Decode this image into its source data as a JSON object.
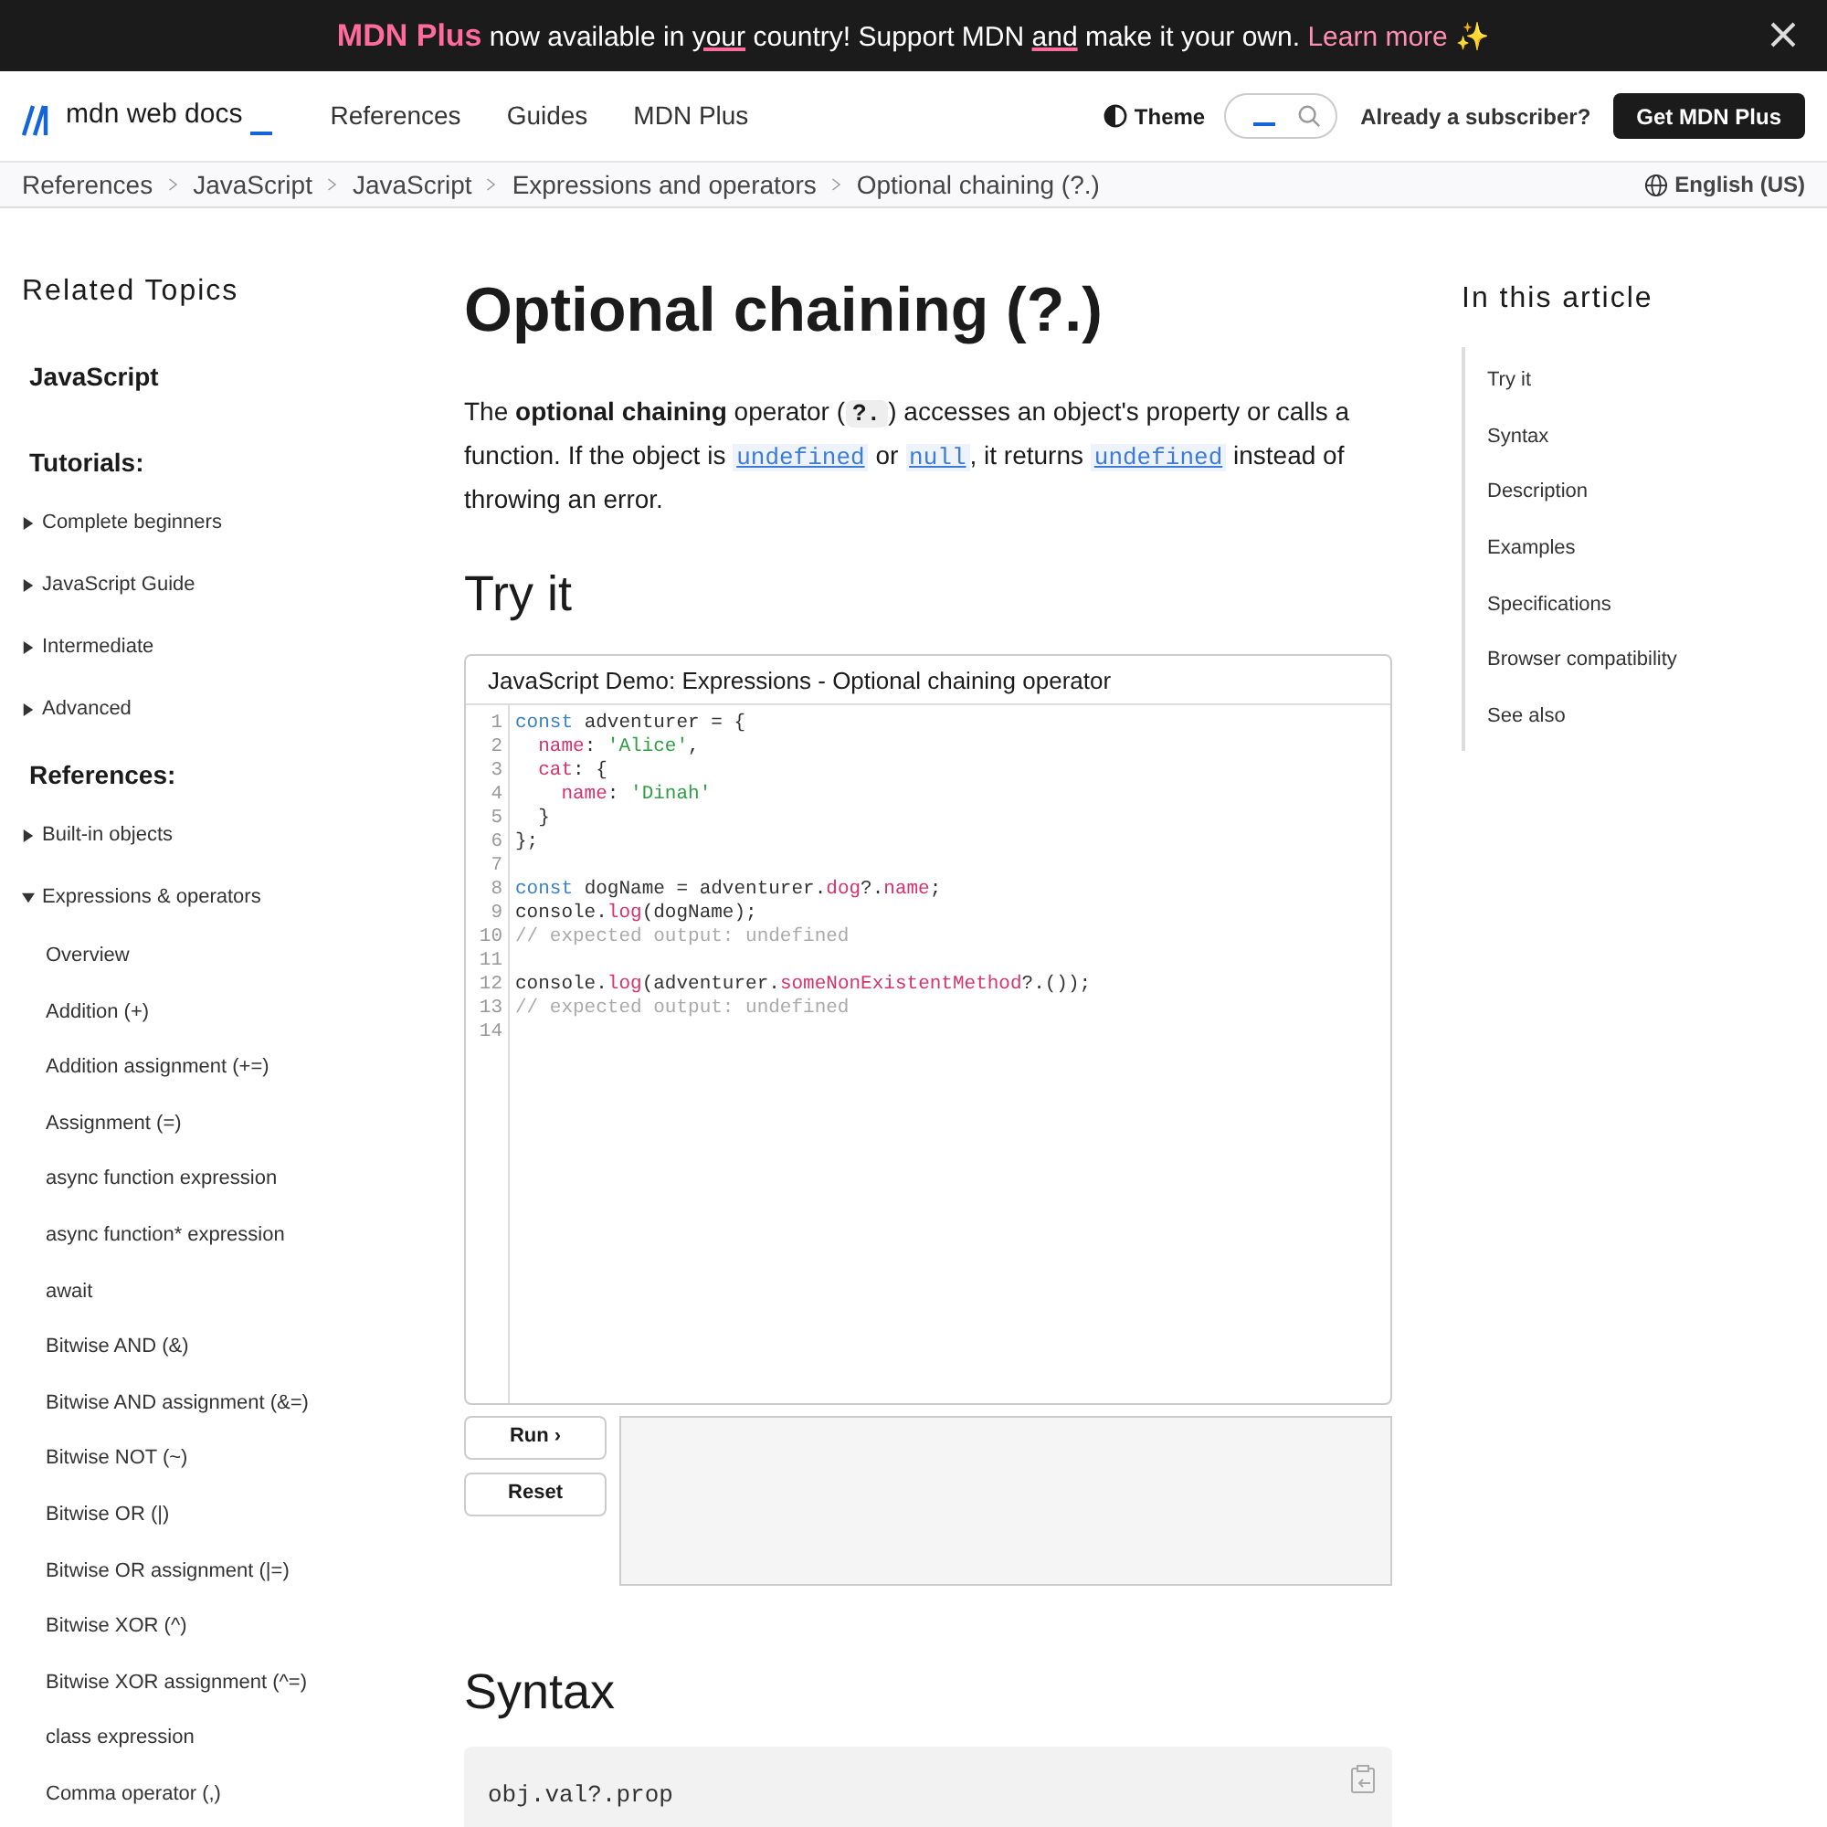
{
  "banner": {
    "parts": [
      {
        "kind": "brand",
        "text": "MDN Plus"
      },
      {
        "kind": "plain",
        "text": " now available in "
      },
      {
        "kind": "underline",
        "text": "your"
      },
      {
        "kind": "plain",
        "text": " country! Support MDN "
      },
      {
        "kind": "underline",
        "text": "and"
      },
      {
        "kind": "plain",
        "text": " make it your own. "
      },
      {
        "kind": "link",
        "text": "Learn more ✨"
      }
    ]
  },
  "header": {
    "logo": "mdn web docs",
    "nav": [
      "References",
      "Guides",
      "MDN Plus"
    ],
    "theme": "Theme",
    "subscriber": "Already a subscriber?",
    "cta": "Get MDN Plus"
  },
  "breadcrumbs": [
    "References",
    "JavaScript",
    "JavaScript",
    "Expressions and operators",
    "Optional chaining (?.)"
  ],
  "language": "English (US)",
  "sidebar": {
    "title": "Related Topics",
    "items": [
      {
        "kind": "heading",
        "text": "JavaScript"
      },
      {
        "kind": "section",
        "text": "Tutorials:"
      },
      {
        "kind": "toggle",
        "text": "Complete beginners",
        "expanded": false
      },
      {
        "kind": "toggle",
        "text": "JavaScript Guide",
        "expanded": false
      },
      {
        "kind": "toggle",
        "text": "Intermediate",
        "expanded": false
      },
      {
        "kind": "toggle",
        "text": "Advanced",
        "expanded": false
      },
      {
        "kind": "section",
        "text": "References:"
      },
      {
        "kind": "toggle",
        "text": "Built-in objects",
        "expanded": false
      },
      {
        "kind": "toggle",
        "text": "Expressions & operators",
        "expanded": true,
        "children": [
          "Overview",
          "Addition (+)",
          "Addition assignment (+=)",
          "Assignment (=)",
          "async function expression",
          "async function* expression",
          "await",
          "Bitwise AND (&)",
          "Bitwise AND assignment (&=)",
          "Bitwise NOT (~)",
          "Bitwise OR (|)",
          "Bitwise OR assignment (|=)",
          "Bitwise XOR (^)",
          "Bitwise XOR assignment (^=)",
          "class expression",
          "Comma operator (,)"
        ]
      }
    ]
  },
  "article": {
    "title": "Optional chaining (?.)",
    "intro": [
      {
        "kind": "text",
        "text": "The "
      },
      {
        "kind": "bold",
        "text": "optional chaining"
      },
      {
        "kind": "text",
        "text": " operator ("
      },
      {
        "kind": "code",
        "text": "?."
      },
      {
        "kind": "text",
        "text": ") accesses an object's property or calls a function. If the object is "
      },
      {
        "kind": "code-link",
        "text": "undefined"
      },
      {
        "kind": "text",
        "text": " or "
      },
      {
        "kind": "code-link",
        "text": "null"
      },
      {
        "kind": "text",
        "text": ", it returns "
      },
      {
        "kind": "code-link",
        "text": "undefined"
      },
      {
        "kind": "text",
        "text": " instead of throwing an error."
      }
    ],
    "try_heading": "Try it",
    "demo": {
      "title": "JavaScript Demo: Expressions - Optional chaining operator",
      "lines": [
        {
          "number": "1",
          "tokens": [
            {
              "kind": "keyword",
              "text": "const"
            },
            {
              "kind": "plain",
              "text": " adventurer = {"
            }
          ]
        },
        {
          "number": "2",
          "tokens": [
            {
              "kind": "property",
              "text": "  name"
            },
            {
              "kind": "plain",
              "text": ": "
            },
            {
              "kind": "string",
              "text": "'Alice'"
            },
            {
              "kind": "plain",
              "text": ","
            }
          ]
        },
        {
          "number": "3",
          "tokens": [
            {
              "kind": "property",
              "text": "  cat"
            },
            {
              "kind": "plain",
              "text": ": {"
            }
          ]
        },
        {
          "number": "4",
          "tokens": [
            {
              "kind": "property",
              "text": "    name"
            },
            {
              "kind": "plain",
              "text": ": "
            },
            {
              "kind": "string",
              "text": "'Dinah'"
            }
          ]
        },
        {
          "number": "5",
          "tokens": [
            {
              "kind": "plain",
              "text": "  }"
            }
          ]
        },
        {
          "number": "6",
          "tokens": [
            {
              "kind": "plain",
              "text": "};"
            }
          ]
        },
        {
          "number": "7"
        },
        {
          "number": "8",
          "tokens": [
            {
              "kind": "keyword",
              "text": "const"
            },
            {
              "kind": "plain",
              "text": " dogName = adventurer."
            },
            {
              "kind": "property",
              "text": "dog"
            },
            {
              "kind": "plain",
              "text": "?."
            },
            {
              "kind": "property",
              "text": "name"
            },
            {
              "kind": "plain",
              "text": ";"
            }
          ]
        },
        {
          "number": "9",
          "tokens": [
            {
              "kind": "plain",
              "text": "console."
            },
            {
              "kind": "property",
              "text": "log"
            },
            {
              "kind": "plain",
              "text": "(dogName);"
            }
          ]
        },
        {
          "number": "10",
          "tokens": [
            {
              "kind": "comment",
              "text": "// expected output: undefined"
            }
          ]
        },
        {
          "number": "11"
        },
        {
          "number": "12",
          "tokens": [
            {
              "kind": "plain",
              "text": "console."
            },
            {
              "kind": "property",
              "text": "log"
            },
            {
              "kind": "plain",
              "text": "(adventurer."
            },
            {
              "kind": "property",
              "text": "someNonExistentMethod"
            },
            {
              "kind": "plain",
              "text": "?.());"
            }
          ]
        },
        {
          "number": "13",
          "tokens": [
            {
              "kind": "comment",
              "text": "// expected output: undefined"
            }
          ]
        },
        {
          "number": "14"
        }
      ],
      "run": "Run ›",
      "reset": "Reset"
    },
    "syntax_heading": "Syntax",
    "syntax_code": "obj.val?.prop"
  },
  "toc": {
    "title": "In this article",
    "items": [
      "Try it",
      "Syntax",
      "Description",
      "Examples",
      "Specifications",
      "Browser compatibility",
      "See also"
    ]
  }
}
